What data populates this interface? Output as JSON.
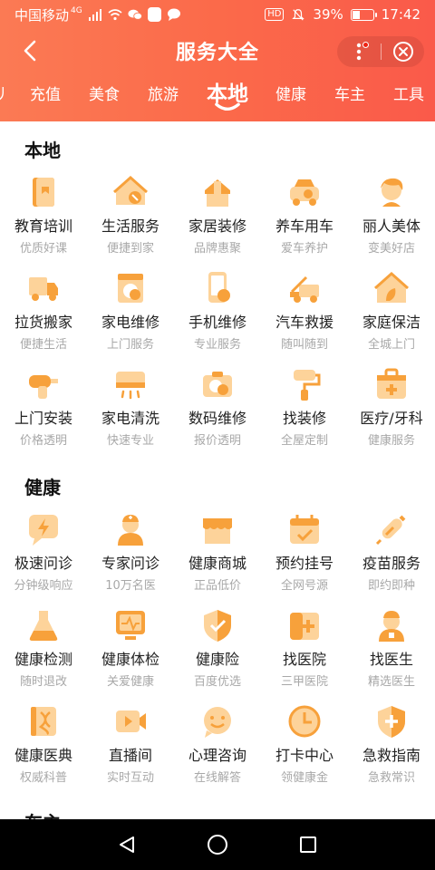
{
  "status": {
    "carrier": "中国移动",
    "net": "4G",
    "hd": "HD",
    "battery": "39%",
    "time": "17:42"
  },
  "header": {
    "title": "服务大全"
  },
  "tabs": [
    {
      "label": "充值"
    },
    {
      "label": "美食"
    },
    {
      "label": "旅游"
    },
    {
      "label": "本地"
    },
    {
      "label": "健康"
    },
    {
      "label": "车主"
    },
    {
      "label": "工具"
    }
  ],
  "sections": [
    {
      "title": "本地",
      "items": [
        {
          "name": "教育培训",
          "sub": "优质好课",
          "icon": "book-icon"
        },
        {
          "name": "生活服务",
          "sub": "便捷到家",
          "icon": "house-wrench-icon"
        },
        {
          "name": "家居装修",
          "sub": "品牌惠聚",
          "icon": "paint-roller-icon"
        },
        {
          "name": "养车用车",
          "sub": "爱车养护",
          "icon": "car-wrench-icon"
        },
        {
          "name": "丽人美体",
          "sub": "变美好店",
          "icon": "woman-icon"
        },
        {
          "name": "拉货搬家",
          "sub": "便捷生活",
          "icon": "truck-icon"
        },
        {
          "name": "家电维修",
          "sub": "上门服务",
          "icon": "washer-icon"
        },
        {
          "name": "手机维修",
          "sub": "专业服务",
          "icon": "phone-wrench-icon"
        },
        {
          "name": "汽车救援",
          "sub": "随叫随到",
          "icon": "tow-truck-icon"
        },
        {
          "name": "家庭保洁",
          "sub": "全城上门",
          "icon": "house-clean-icon"
        },
        {
          "name": "上门安装",
          "sub": "价格透明",
          "icon": "drill-icon"
        },
        {
          "name": "家电清洗",
          "sub": "快速专业",
          "icon": "aircon-icon"
        },
        {
          "name": "数码维修",
          "sub": "报价透明",
          "icon": "camera-icon"
        },
        {
          "name": "找装修",
          "sub": "全屋定制",
          "icon": "roller-icon"
        },
        {
          "name": "医疗/牙科",
          "sub": "健康服务",
          "icon": "medkit-icon"
        }
      ]
    },
    {
      "title": "健康",
      "items": [
        {
          "name": "极速问诊",
          "sub": "分钟级响应",
          "icon": "lightning-chat-icon"
        },
        {
          "name": "专家问诊",
          "sub": "10万名医",
          "icon": "doctor-icon"
        },
        {
          "name": "健康商城",
          "sub": "正品低价",
          "icon": "store-icon"
        },
        {
          "name": "预约挂号",
          "sub": "全网号源",
          "icon": "calendar-check-icon"
        },
        {
          "name": "疫苗服务",
          "sub": "即约即种",
          "icon": "syringe-icon"
        },
        {
          "name": "健康检测",
          "sub": "随时退改",
          "icon": "flask-icon"
        },
        {
          "name": "健康体检",
          "sub": "关爱健康",
          "icon": "monitor-pulse-icon"
        },
        {
          "name": "健康险",
          "sub": "百度优选",
          "icon": "shield-check-icon"
        },
        {
          "name": "找医院",
          "sub": "三甲医院",
          "icon": "hospital-icon"
        },
        {
          "name": "找医生",
          "sub": "精选医生",
          "icon": "nurse-icon"
        },
        {
          "name": "健康医典",
          "sub": "权威科普",
          "icon": "dna-book-icon"
        },
        {
          "name": "直播间",
          "sub": "实时互动",
          "icon": "video-icon"
        },
        {
          "name": "心理咨询",
          "sub": "在线解答",
          "icon": "smile-chat-icon"
        },
        {
          "name": "打卡中心",
          "sub": "领健康金",
          "icon": "clock-icon"
        },
        {
          "name": "急救指南",
          "sub": "急救常识",
          "icon": "shield-plus-icon"
        }
      ]
    },
    {
      "title": "车主"
    }
  ],
  "colors": {
    "accent": "#fb6a4a",
    "icon_dark": "#f7a13b",
    "icon_light": "#fdd39a"
  }
}
